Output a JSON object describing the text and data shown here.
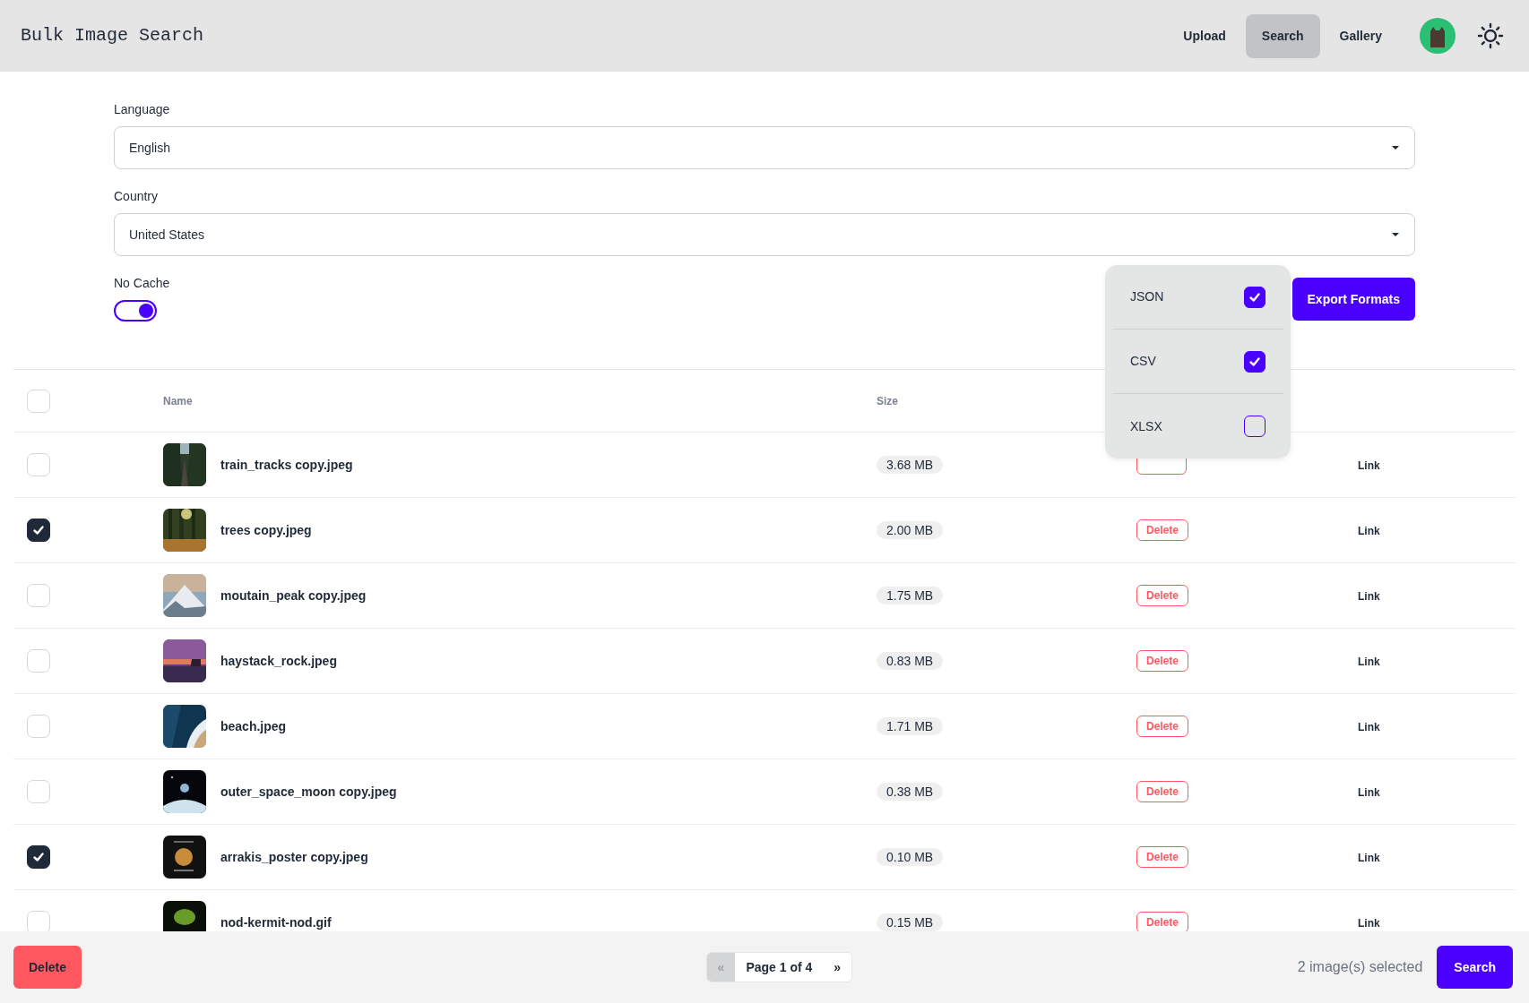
{
  "app": {
    "title": "Bulk Image Search"
  },
  "nav": [
    {
      "label": "Upload",
      "selected": false
    },
    {
      "label": "Search",
      "selected": true
    },
    {
      "label": "Gallery",
      "selected": false
    }
  ],
  "form": {
    "fields": [
      {
        "label": "Language",
        "value": "English"
      },
      {
        "label": "Country",
        "value": "United States"
      }
    ],
    "no_cache": {
      "label": "No Cache",
      "on": true
    }
  },
  "export": {
    "button": "Export Formats",
    "formats": [
      {
        "label": "JSON",
        "checked": true
      },
      {
        "label": "CSV",
        "checked": true
      },
      {
        "label": "XLSX",
        "checked": false
      }
    ]
  },
  "table": {
    "select_all": {
      "checked": false
    },
    "columns": [
      "Name",
      "Size"
    ],
    "rows": [
      {
        "name": "train_tracks copy.jpeg",
        "size": "3.68 MB",
        "checked": false,
        "link": "Link"
      },
      {
        "name": "trees copy.jpeg",
        "size": "2.00 MB",
        "checked": true,
        "delete": "Delete",
        "link": "Link"
      },
      {
        "name": "moutain_peak copy.jpeg",
        "size": "1.75 MB",
        "checked": false,
        "delete": "Delete",
        "link": "Link"
      },
      {
        "name": "haystack_rock.jpeg",
        "size": "0.83 MB",
        "checked": false,
        "delete": "Delete",
        "link": "Link"
      },
      {
        "name": "beach.jpeg",
        "size": "1.71 MB",
        "checked": false,
        "delete": "Delete",
        "link": "Link"
      },
      {
        "name": "outer_space_moon copy.jpeg",
        "size": "0.38 MB",
        "checked": false,
        "delete": "Delete",
        "link": "Link"
      },
      {
        "name": "arrakis_poster copy.jpeg",
        "size": "0.10 MB",
        "checked": true,
        "delete": "Delete",
        "link": "Link"
      },
      {
        "name": "nod-kermit-nod.gif",
        "size": "0.15 MB",
        "checked": false,
        "delete": "Delete",
        "link": "Link"
      }
    ]
  },
  "footer": {
    "delete": "Delete",
    "pager": {
      "prev": "«",
      "page": "Page 1 of 4",
      "next": "»",
      "prev_disabled": true
    },
    "selected_count": "2 image(s) selected",
    "search": "Search"
  }
}
